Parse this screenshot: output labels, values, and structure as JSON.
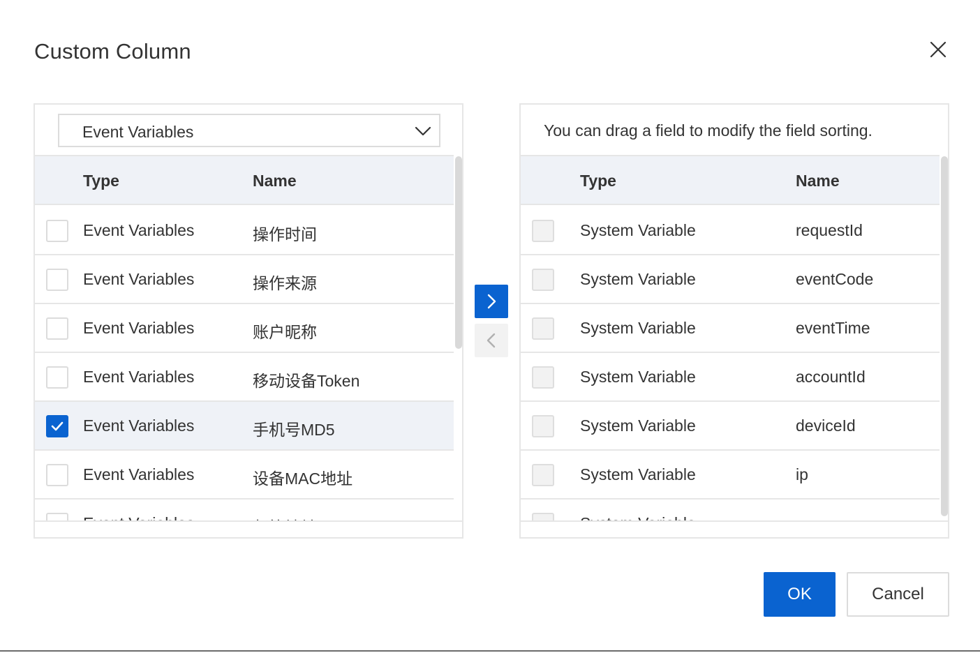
{
  "dialog": {
    "title": "Custom Column",
    "close_icon": "close-icon"
  },
  "left_panel": {
    "select": {
      "value": "Event Variables",
      "icon": "chevron-down-icon"
    },
    "columns": {
      "type": "Type",
      "name": "Name"
    },
    "rows": [
      {
        "type": "Event Variables",
        "name": "操作时间",
        "checked": false
      },
      {
        "type": "Event Variables",
        "name": "操作来源",
        "checked": false
      },
      {
        "type": "Event Variables",
        "name": "账户昵称",
        "checked": false
      },
      {
        "type": "Event Variables",
        "name": "移动设备Token",
        "checked": false
      },
      {
        "type": "Event Variables",
        "name": "手机号MD5",
        "checked": true
      },
      {
        "type": "Event Variables",
        "name": "设备MAC地址",
        "checked": false
      },
      {
        "type": "Event Variables",
        "name": "邮箱地址",
        "checked": false
      }
    ]
  },
  "transfer": {
    "move_right_icon": "chevron-right-icon",
    "move_left_icon": "chevron-left-icon"
  },
  "right_panel": {
    "hint": "You can drag a field to modify the field sorting.",
    "columns": {
      "type": "Type",
      "name": "Name"
    },
    "rows": [
      {
        "type": "System Variable",
        "name": "requestId"
      },
      {
        "type": "System Variable",
        "name": "eventCode"
      },
      {
        "type": "System Variable",
        "name": "eventTime"
      },
      {
        "type": "System Variable",
        "name": "accountId"
      },
      {
        "type": "System Variable",
        "name": "deviceId"
      },
      {
        "type": "System Variable",
        "name": "ip"
      },
      {
        "type": "System Variable",
        "name": ""
      }
    ]
  },
  "footer": {
    "ok_label": "OK",
    "cancel_label": "Cancel"
  },
  "colors": {
    "primary": "#0a63d0",
    "header_bg": "#eff2f7",
    "border": "#e6e6e6"
  }
}
